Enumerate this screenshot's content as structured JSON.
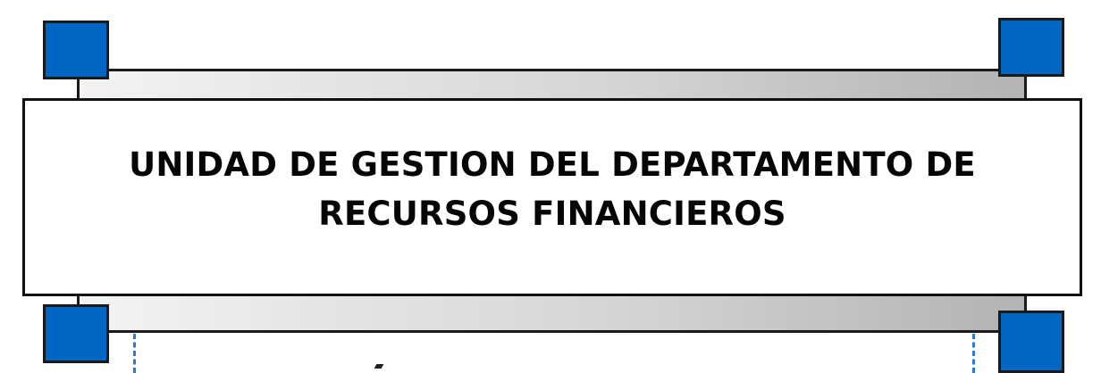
{
  "title": {
    "line1": "UNIDAD DE GESTION DEL DEPARTAMENTO DE",
    "line2": "RECURSOS FINANCIEROS"
  },
  "colors": {
    "accent_blue": "#0066c4",
    "dash_blue": "#2a7ad0",
    "border": "#1a1a1a"
  }
}
